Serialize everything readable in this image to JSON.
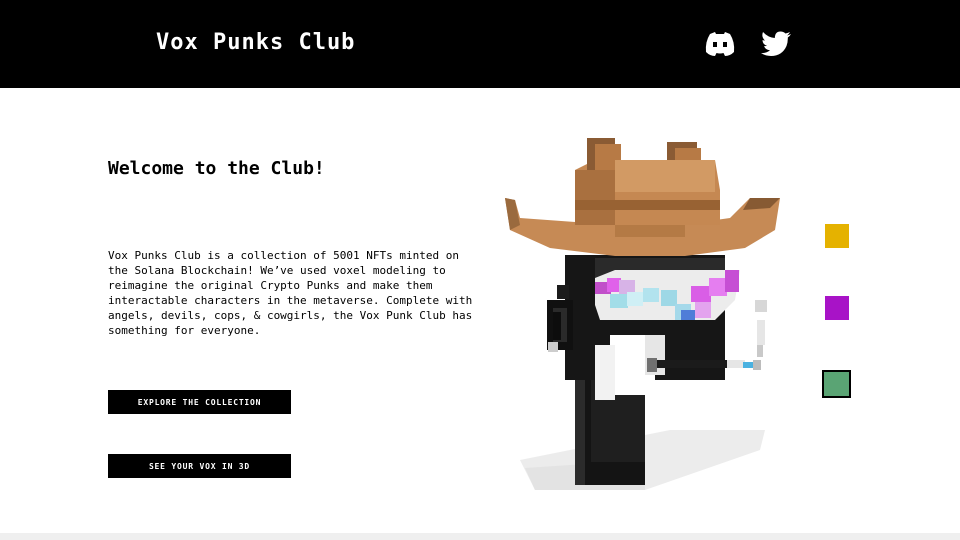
{
  "header": {
    "brand": "Vox Punks Club",
    "icons": [
      "discord-icon",
      "twitter-icon"
    ]
  },
  "hero": {
    "headline": "Welcome to the Club!",
    "description": "Vox Punks Club is a collection of 5001 NFTs minted on the Solana Blockchain! We’ve used voxel modeling to reimagine the original Crypto Punks and make them interactable characters in the metaverse. Complete with angels, devils, cops, & cowgirls, the Vox Punk Club has something for everyone.",
    "buttons": {
      "explore": "EXPLORE THE COLLECTION",
      "view3d": "SEE YOUR VOX IN 3D"
    }
  },
  "colors": {
    "header_bg": "#000000",
    "page_bg": "#ffffff",
    "button_bg": "#000000",
    "swatches": [
      "#e5b200",
      "#a813c7",
      "#5aa474"
    ]
  }
}
